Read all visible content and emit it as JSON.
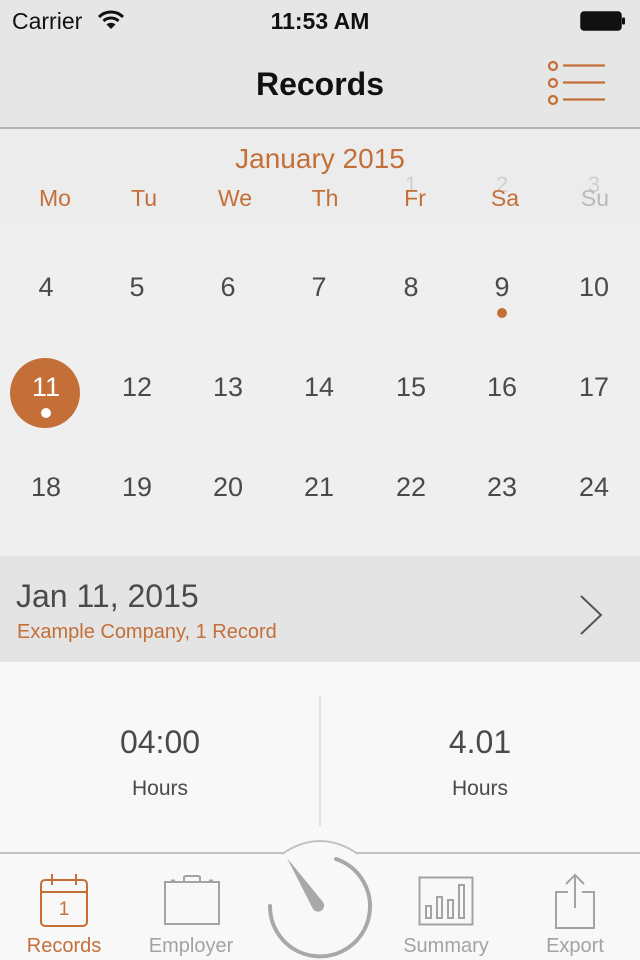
{
  "status_bar": {
    "carrier": "Carrier",
    "time": "11:53 AM",
    "wifi_icon": "wifi-icon",
    "battery_icon": "battery-icon"
  },
  "nav": {
    "title": "Records",
    "menu_icon": "list-menu-icon"
  },
  "calendar": {
    "month_title": "January 2015",
    "weekdays": [
      "Mo",
      "Tu",
      "We",
      "Th",
      "Fr",
      "Sa",
      "Su"
    ],
    "previous_week_days": [
      "1",
      "2",
      "3"
    ],
    "weeks": [
      [
        "4",
        "5",
        "6",
        "7",
        "8",
        "9",
        "10"
      ],
      [
        "11",
        "12",
        "13",
        "14",
        "15",
        "16",
        "17"
      ],
      [
        "18",
        "19",
        "20",
        "21",
        "22",
        "23",
        "24"
      ]
    ],
    "selected_day": "11",
    "days_with_records": [
      "9",
      "11"
    ]
  },
  "selected_summary": {
    "date": "Jan 11, 2015",
    "subtitle": "Example Company, 1 Record"
  },
  "stats": [
    {
      "value": "04:00",
      "label": "Hours"
    },
    {
      "value": "4.01",
      "label": "Hours"
    }
  ],
  "tab_bar": {
    "tabs": [
      {
        "label": "Records",
        "icon": "calendar-icon",
        "icon_text": "1",
        "active": true
      },
      {
        "label": "Employer",
        "icon": "briefcase-icon",
        "active": false
      },
      {
        "label": "Summary",
        "icon": "bar-chart-icon",
        "active": false
      },
      {
        "label": "Export",
        "icon": "share-icon",
        "active": false
      }
    ],
    "center_button_icon": "stopwatch-icon"
  },
  "colors": {
    "accent": "#c46f38",
    "text": "#4a4a4a",
    "inactive": "#a3a3a3"
  }
}
